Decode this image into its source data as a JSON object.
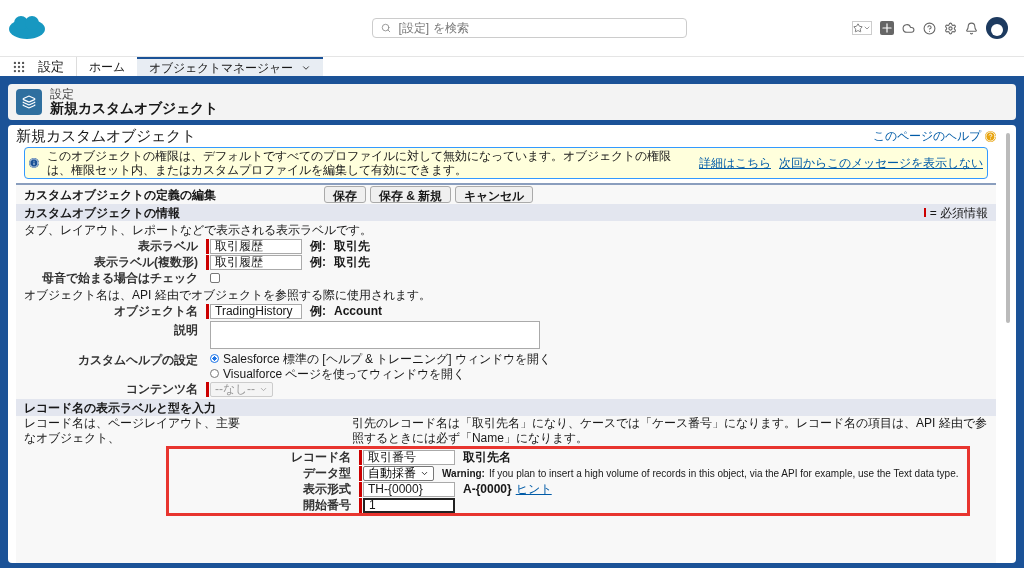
{
  "header": {
    "search": {
      "placeholder": "[設定] を検索"
    }
  },
  "nav": {
    "app_name": "設定",
    "tabs": [
      {
        "label": "ホーム",
        "selected": false
      },
      {
        "label": "オブジェクトマネージャー",
        "selected": true
      }
    ]
  },
  "page_header": {
    "breadcrumb": "設定",
    "title": "新規カスタムオブジェクト"
  },
  "main": {
    "title": "新規カスタムオブジェクト",
    "help_link": "このページのヘルプ",
    "info": {
      "text": "このオブジェクトの権限は、デフォルトですべてのプロファイルに対して無効になっています。オブジェクトの権限は、権限セット内、またはカスタムプロファイルを編集して有効にできます。",
      "links": [
        "詳細はこちら",
        "次回からこのメッセージを表示しない"
      ]
    },
    "edit_block": {
      "title": "カスタムオブジェクトの定義の編集",
      "buttons": [
        "保存",
        "保存 & 新規",
        "キャンセル"
      ]
    },
    "sections": [
      {
        "title": "カスタムオブジェクトの情報",
        "legend": "= 必須情報",
        "highlighted": false,
        "items": [
          {
            "kind": "note",
            "text": "タブ、レイアウト、レポートなどで表示される表示ラベルです。"
          },
          {
            "kind": "text",
            "label": "表示ラベル",
            "value": "取引履歴",
            "required": true,
            "example": "例:",
            "example_value": "取引先"
          },
          {
            "kind": "text",
            "label": "表示ラベル(複数形)",
            "value": "取引履歴",
            "required": true,
            "example": "例:",
            "example_value": "取引先"
          },
          {
            "kind": "checkbox",
            "label": "母音で始まる場合はチェック",
            "checked": false
          },
          {
            "kind": "note",
            "text": "オブジェクト名は、API 経由でオブジェクトを参照する際に使用されます。"
          },
          {
            "kind": "text",
            "label": "オブジェクト名",
            "value": "TradingHistory",
            "required": true,
            "example": "例:",
            "example_value": "Account"
          },
          {
            "kind": "textarea",
            "label": "説明"
          },
          {
            "kind": "radio",
            "label": "カスタムヘルプの設定",
            "options": [
              {
                "label": "Salesforce 標準の [ヘルプ & トレーニング] ウィンドウを開く",
                "selected": true
              },
              {
                "label": "Visualforce ページを使ってウィンドウを開く",
                "selected": false
              }
            ]
          },
          {
            "kind": "select",
            "label": "コンテンツ名",
            "value": "--なし--",
            "disabled": true
          }
        ]
      },
      {
        "title": "レコード名の表示ラベルと型を入力",
        "highlighted": true,
        "items": [
          {
            "kind": "note_split",
            "parts": [
              "レコード名は、ページレイアウト、主要なオブジェクト、",
              "引先のレコード名は「取引先名」になり、ケースでは「ケース番号」になります。レコード名の項目は、API 経由で参照するときには必ず「Name」になります。"
            ]
          },
          {
            "kind": "text",
            "label": "レコード名",
            "value": "取引番号",
            "required": true,
            "example_value": "取引先名"
          },
          {
            "kind": "select",
            "label": "データ型",
            "value": "自動採番",
            "disabled": false,
            "warning_label": "Warning:",
            "warning": "If you plan to insert a high volume of records in this object, via the API for example, use the Text data type."
          },
          {
            "kind": "text",
            "label": "表示形式",
            "value": "TH-{0000}",
            "required": true,
            "example_value": "A-{0000}",
            "hint_link": "ヒント"
          },
          {
            "kind": "text",
            "label": "開始番号",
            "value": "1",
            "required": true,
            "focused": true
          }
        ]
      }
    ]
  }
}
